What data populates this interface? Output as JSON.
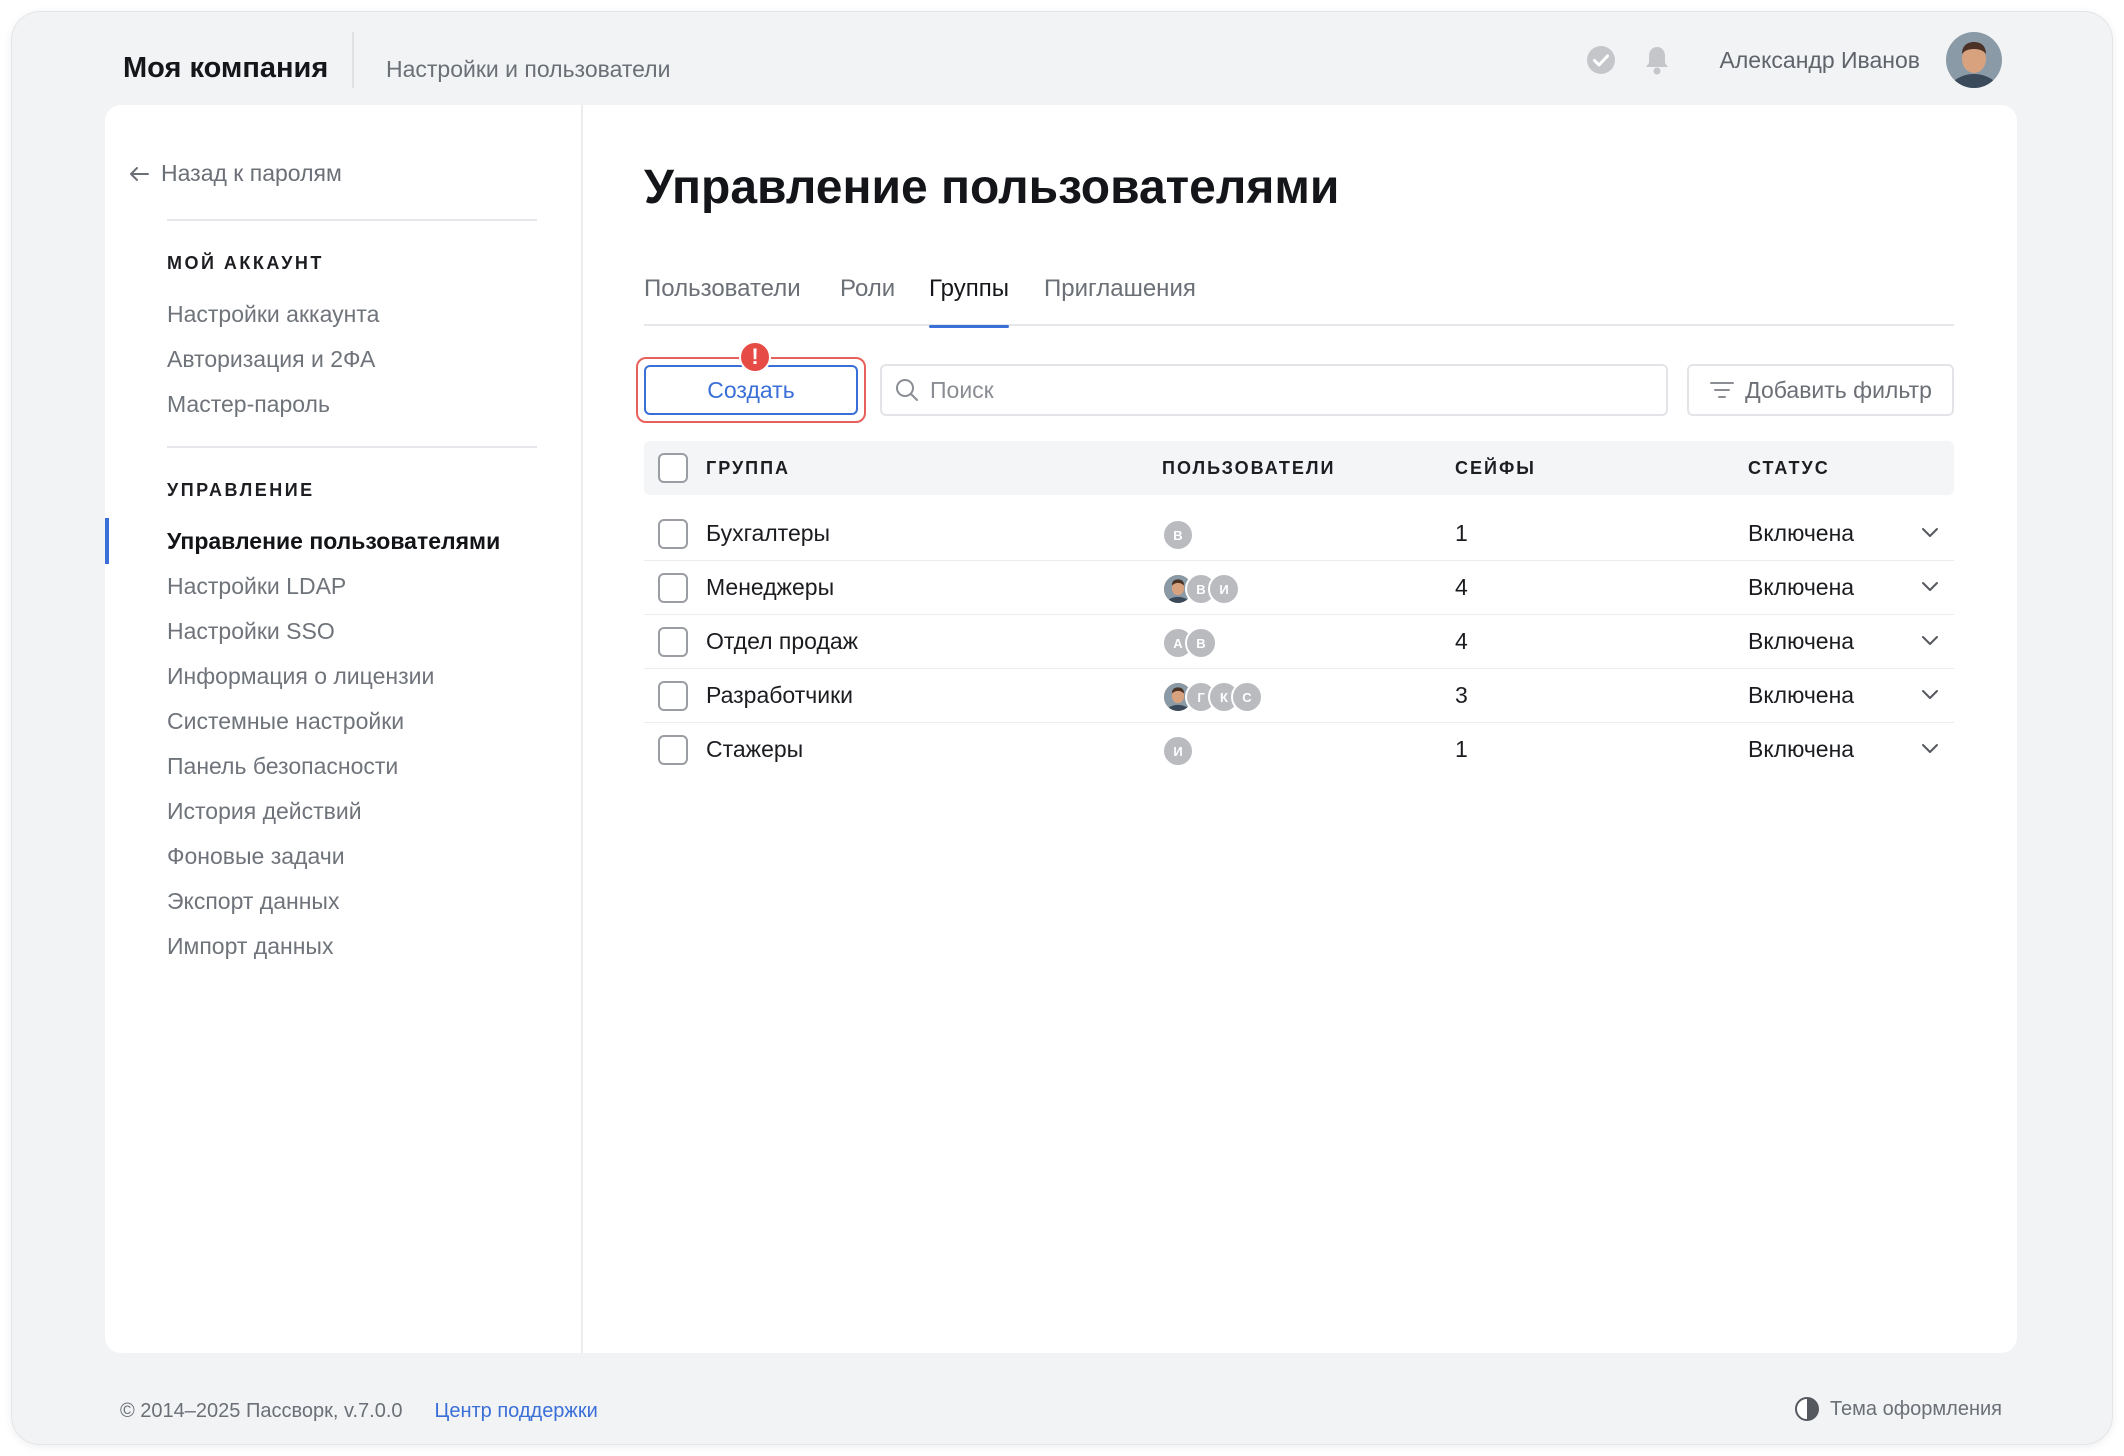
{
  "header": {
    "company": "Моя компания",
    "breadcrumb": "Настройки и пользователи",
    "user_name": "Александр Иванов"
  },
  "sidebar": {
    "back": "Назад к паролям",
    "account_title": "МОЙ АККАУНТ",
    "account_items": [
      "Настройки аккаунта",
      "Авторизация и 2ФА",
      "Мастер-пароль"
    ],
    "manage_title": "УПРАВЛЕНИЕ",
    "manage_items": [
      "Управление пользователями",
      "Настройки LDAP",
      "Настройки SSO",
      "Информация о лицензии",
      "Системные настройки",
      "Панель безопасности",
      "История действий",
      "Фоновые задачи",
      "Экспорт данных",
      "Импорт данных"
    ],
    "active_index": 0
  },
  "main": {
    "title": "Управление пользователями",
    "tabs": [
      "Пользователи",
      "Роли",
      "Группы",
      "Приглашения"
    ],
    "active_tab": 2,
    "create_label": "Создать",
    "alert_mark": "!",
    "search_placeholder": "Поиск",
    "filter_label": "Добавить фильтр",
    "columns": {
      "group": "ГРУППА",
      "users": "ПОЛЬЗОВАТЕЛИ",
      "vaults": "СЕЙФЫ",
      "status": "СТАТУС"
    },
    "rows": [
      {
        "name": "Бухгалтеры",
        "avatars": [
          "В"
        ],
        "vaults": "1",
        "status": "Включена"
      },
      {
        "name": "Менеджеры",
        "avatars": [
          "photo",
          "В",
          "И"
        ],
        "vaults": "4",
        "status": "Включена"
      },
      {
        "name": "Отдел продаж",
        "avatars": [
          "А",
          "В"
        ],
        "vaults": "4",
        "status": "Включена"
      },
      {
        "name": "Разработчики",
        "avatars": [
          "photo",
          "Г",
          "К",
          "С"
        ],
        "vaults": "3",
        "status": "Включена"
      },
      {
        "name": "Стажеры",
        "avatars": [
          "И"
        ],
        "vaults": "1",
        "status": "Включена"
      }
    ]
  },
  "footer": {
    "copyright": "© 2014–2025 Пассворк, v.7.0.0",
    "support": "Центр поддержки",
    "theme": "Тема оформления"
  },
  "colors": {
    "accent": "#3a6fd8",
    "alert": "#e64b45"
  }
}
